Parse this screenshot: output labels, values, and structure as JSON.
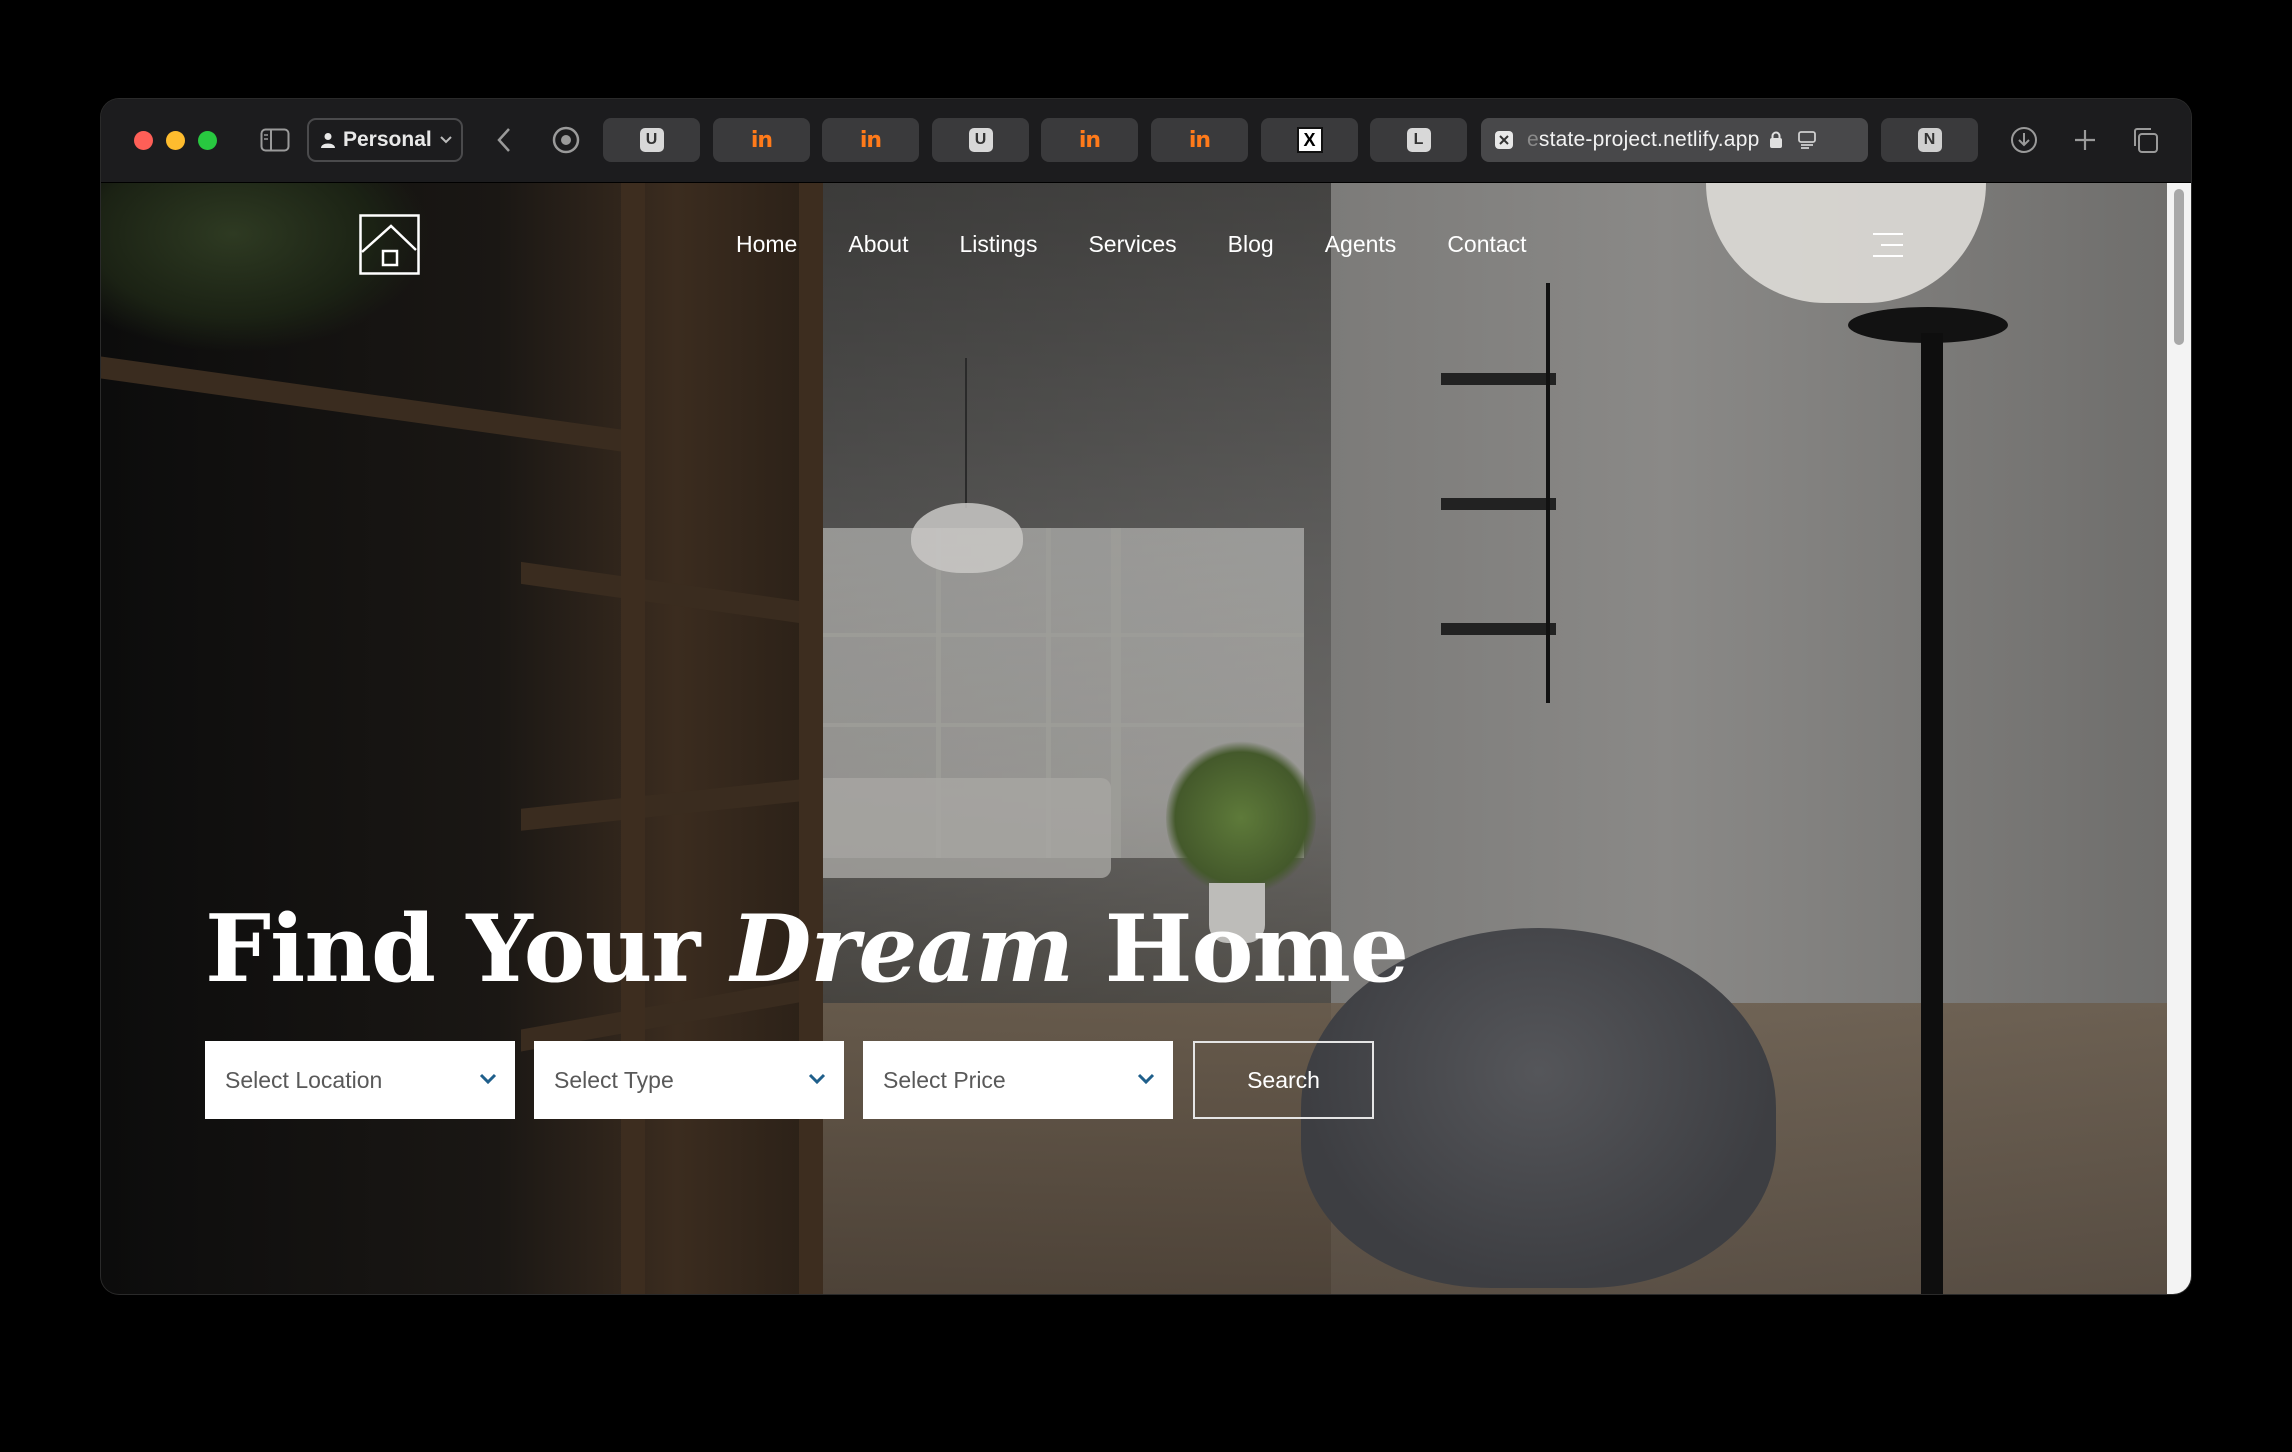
{
  "browser": {
    "profile_label": "Personal",
    "tabs": [
      {
        "favicon": "U"
      },
      {
        "favicon": "in"
      },
      {
        "favicon": "in"
      },
      {
        "favicon": "U"
      },
      {
        "favicon": "in"
      },
      {
        "favicon": "in"
      },
      {
        "favicon": "X"
      },
      {
        "favicon": "L"
      },
      {
        "favicon": "N"
      }
    ],
    "active_url_prefix": "e",
    "active_url": "state-project.netlify.app"
  },
  "site": {
    "nav": [
      "Home",
      "About",
      "Listings",
      "Services",
      "Blog",
      "Agents",
      "Contact"
    ],
    "hero": {
      "title_part1": "Find Your ",
      "title_emphasis": "Dream",
      "title_part2": " Home"
    },
    "search": {
      "location_placeholder": "Select Location",
      "type_placeholder": "Select Type",
      "price_placeholder": "Select Price",
      "button_label": "Search"
    }
  },
  "colors": {
    "chevron": "#1f5f8b",
    "toolbar_bg": "#1c1c1e",
    "favicon_in": "#ff7a1a"
  }
}
